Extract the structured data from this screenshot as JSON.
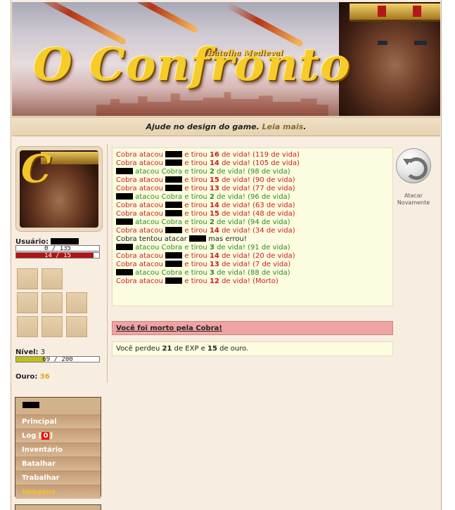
{
  "banner": {
    "title": "O Confronto",
    "subtitle": "Batalha Medieval"
  },
  "news": {
    "text": "Ajude no design do game.",
    "link": "Leia mais",
    "end": "."
  },
  "sidebar": {
    "user_label": "Usuário:",
    "hp_bar": {
      "text": "0 / 135",
      "fraction": 0.0,
      "color": "#b31313"
    },
    "mp_bar": {
      "text": "14 / 15",
      "fraction": 0.93,
      "color": "#b31313"
    },
    "level_label": "Nível:",
    "level_value": "3",
    "exp_bar": {
      "text": "69 / 200",
      "fraction": 0.345,
      "color": "#bfbf1b"
    },
    "gold_label": "Ouro:",
    "gold_value": "36"
  },
  "menu": {
    "items": [
      {
        "label": "Principal"
      },
      {
        "label": "Log",
        "badge": "0"
      },
      {
        "label": "Inventário"
      },
      {
        "label": "Batalhar"
      },
      {
        "label": "Trabalhar"
      },
      {
        "label": "Imagens",
        "active": true
      }
    ]
  },
  "battle": {
    "log": [
      {
        "type": "enemy",
        "a": "Cobra atacou",
        "b": "e tirou",
        "dmg": "16",
        "c": "de vida! (119 de vida)"
      },
      {
        "type": "enemy",
        "a": "Cobra atacou",
        "b": "e tirou",
        "dmg": "14",
        "c": "de vida! (105 de vida)"
      },
      {
        "type": "player",
        "a": "atacou Cobra e tirou",
        "dmg": "2",
        "c": "de vida! (98 de vida)"
      },
      {
        "type": "enemy",
        "a": "Cobra atacou",
        "b": "e tirou",
        "dmg": "15",
        "c": "de vida! (90 de vida)"
      },
      {
        "type": "enemy",
        "a": "Cobra atacou",
        "b": "e tirou",
        "dmg": "13",
        "c": "de vida! (77 de vida)"
      },
      {
        "type": "player",
        "a": "atacou Cobra e tirou",
        "dmg": "2",
        "c": "de vida! (96 de vida)"
      },
      {
        "type": "enemy",
        "a": "Cobra atacou",
        "b": "e tirou",
        "dmg": "14",
        "c": "de vida! (63 de vida)"
      },
      {
        "type": "enemy",
        "a": "Cobra atacou",
        "b": "e tirou",
        "dmg": "15",
        "c": "de vida! (48 de vida)"
      },
      {
        "type": "player",
        "a": "atacou Cobra e tirou",
        "dmg": "2",
        "c": "de vida! (94 de vida)"
      },
      {
        "type": "enemy",
        "a": "Cobra atacou",
        "b": "e tirou",
        "dmg": "14",
        "c": "de vida! (34 de vida)"
      },
      {
        "type": "miss",
        "a": "Cobra tentou atacar",
        "c": "mas errou!"
      },
      {
        "type": "player",
        "a": "atacou Cobra e tirou",
        "dmg": "3",
        "c": "de vida! (91 de vida)"
      },
      {
        "type": "enemy",
        "a": "Cobra atacou",
        "b": "e tirou",
        "dmg": "14",
        "c": "de vida! (20 de vida)"
      },
      {
        "type": "enemy",
        "a": "Cobra atacou",
        "b": "e tirou",
        "dmg": "13",
        "c": "de vida! (7 de vida)"
      },
      {
        "type": "player",
        "a": "atacou Cobra e tirou",
        "dmg": "3",
        "c": "de vida! (88 de vida)"
      },
      {
        "type": "enemy",
        "a": "Cobra atacou",
        "b": "e tirou",
        "dmg": "12",
        "c": "de vida! (Morto)"
      }
    ],
    "again_label": "Atacar Novamente",
    "death_text": "Você foi morto pela Cobra!",
    "result": {
      "a": "Você perdeu",
      "exp": "21",
      "b": "de EXP e",
      "gold": "15",
      "c": "de ouro."
    }
  }
}
